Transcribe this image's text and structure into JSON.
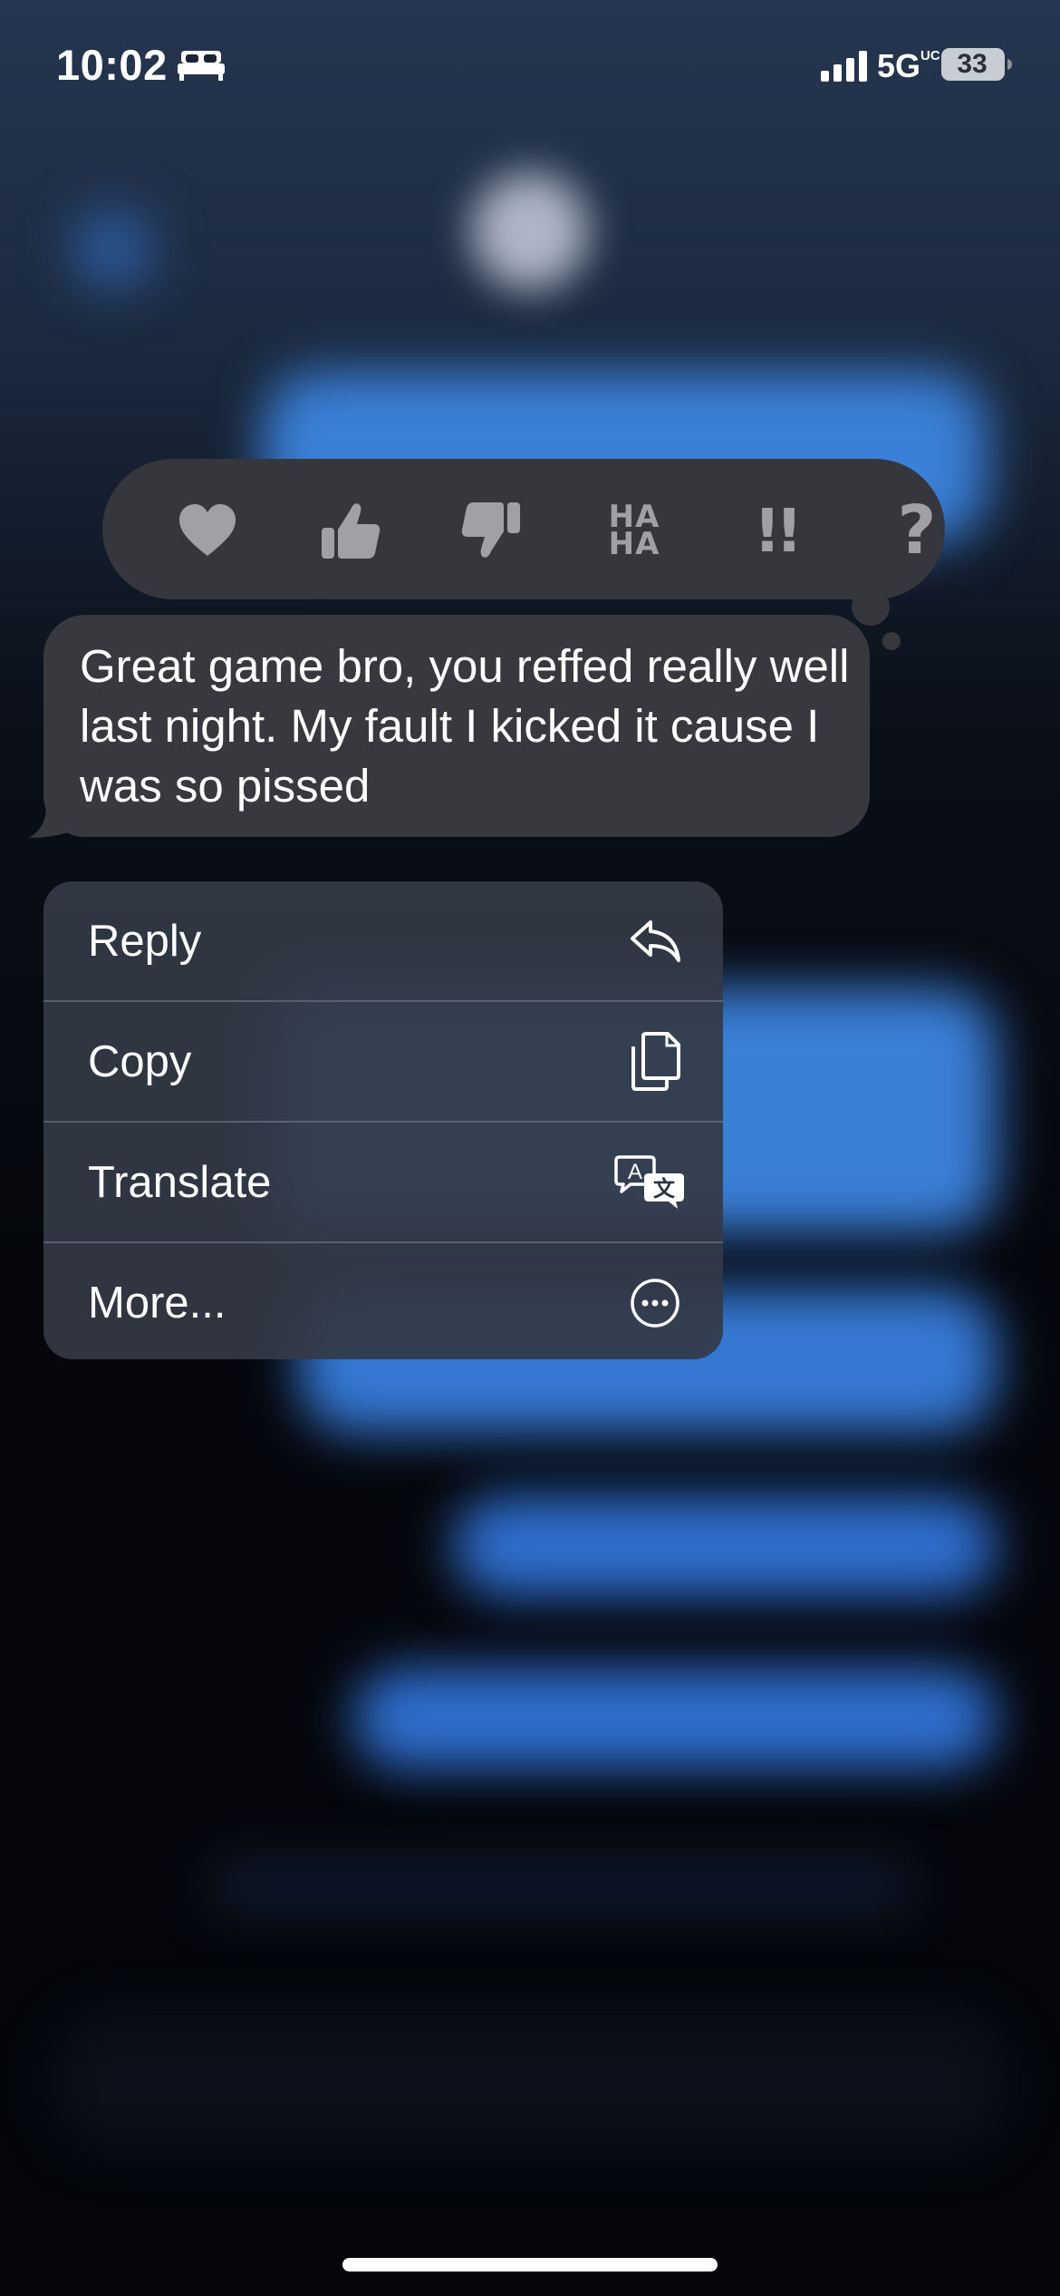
{
  "status_bar": {
    "time": "10:02",
    "network": "5G",
    "network_suffix": "UC",
    "battery": "33",
    "icons": [
      "bed-icon",
      "signal-icon",
      "battery-icon"
    ]
  },
  "tapbacks": [
    {
      "name": "heart",
      "icon": "heart-icon"
    },
    {
      "name": "thumbs-up",
      "icon": "thumbs-up-icon"
    },
    {
      "name": "thumbs-down",
      "icon": "thumbs-down-icon"
    },
    {
      "name": "haha",
      "icon": "haha-icon",
      "label_top": "HA",
      "label_bottom": "HA"
    },
    {
      "name": "emphasize",
      "icon": "double-exclamation-icon",
      "label": "!!"
    },
    {
      "name": "question",
      "icon": "question-mark-icon",
      "label": "?"
    }
  ],
  "message": {
    "text": "Great game bro, you reffed really well last night. My fault I kicked it cause I was so pissed"
  },
  "context_menu": {
    "items": [
      {
        "label": "Reply",
        "icon": "reply-arrow-icon"
      },
      {
        "label": "Copy",
        "icon": "copy-icon"
      },
      {
        "label": "Translate",
        "icon": "translate-icon"
      },
      {
        "label": "More...",
        "icon": "ellipsis-circle-icon"
      }
    ]
  },
  "colors": {
    "accent_blue": "#3a80d8",
    "bubble_gray": "#38393e",
    "tapback_bar": "#36373c",
    "tapback_icon": "#a0a1a6",
    "menu_background": "#343a46"
  }
}
